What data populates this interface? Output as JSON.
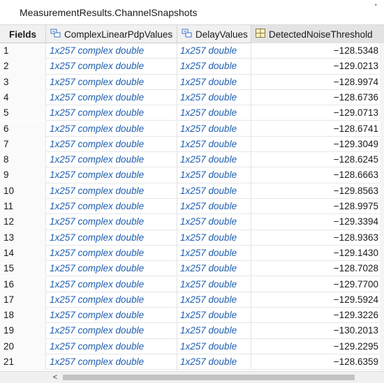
{
  "window": {
    "title": "MeasurementResults.ChannelSnapshots"
  },
  "table": {
    "headers": {
      "fields": "Fields",
      "col1": "ComplexLinearPdpValues",
      "col2": "DelayValues",
      "col3": "DetectedNoiseThreshold"
    },
    "header_icons": {
      "col1": "struct-field-icon",
      "col2": "struct-field-icon",
      "col3": "numeric-grid-icon"
    },
    "rows": [
      {
        "index": "1",
        "pdp": "1x257 complex double",
        "delay": "1x257 double",
        "noise": "−128.5348"
      },
      {
        "index": "2",
        "pdp": "1x257 complex double",
        "delay": "1x257 double",
        "noise": "−129.0213"
      },
      {
        "index": "3",
        "pdp": "1x257 complex double",
        "delay": "1x257 double",
        "noise": "−128.9974"
      },
      {
        "index": "4",
        "pdp": "1x257 complex double",
        "delay": "1x257 double",
        "noise": "−128.6736"
      },
      {
        "index": "5",
        "pdp": "1x257 complex double",
        "delay": "1x257 double",
        "noise": "−129.0713"
      },
      {
        "index": "6",
        "pdp": "1x257 complex double",
        "delay": "1x257 double",
        "noise": "−128.6741"
      },
      {
        "index": "7",
        "pdp": "1x257 complex double",
        "delay": "1x257 double",
        "noise": "−129.3049"
      },
      {
        "index": "8",
        "pdp": "1x257 complex double",
        "delay": "1x257 double",
        "noise": "−128.6245"
      },
      {
        "index": "9",
        "pdp": "1x257 complex double",
        "delay": "1x257 double",
        "noise": "−128.6663"
      },
      {
        "index": "10",
        "pdp": "1x257 complex double",
        "delay": "1x257 double",
        "noise": "−129.8563"
      },
      {
        "index": "11",
        "pdp": "1x257 complex double",
        "delay": "1x257 double",
        "noise": "−128.9975"
      },
      {
        "index": "12",
        "pdp": "1x257 complex double",
        "delay": "1x257 double",
        "noise": "−129.3394"
      },
      {
        "index": "13",
        "pdp": "1x257 complex double",
        "delay": "1x257 double",
        "noise": "−128.9363"
      },
      {
        "index": "14",
        "pdp": "1x257 complex double",
        "delay": "1x257 double",
        "noise": "−129.1430"
      },
      {
        "index": "15",
        "pdp": "1x257 complex double",
        "delay": "1x257 double",
        "noise": "−128.7028"
      },
      {
        "index": "16",
        "pdp": "1x257 complex double",
        "delay": "1x257 double",
        "noise": "−129.7700"
      },
      {
        "index": "17",
        "pdp": "1x257 complex double",
        "delay": "1x257 double",
        "noise": "−129.5924"
      },
      {
        "index": "18",
        "pdp": "1x257 complex double",
        "delay": "1x257 double",
        "noise": "−129.3226"
      },
      {
        "index": "19",
        "pdp": "1x257 complex double",
        "delay": "1x257 double",
        "noise": "−130.2013"
      },
      {
        "index": "20",
        "pdp": "1x257 complex double",
        "delay": "1x257 double",
        "noise": "−129.2295"
      },
      {
        "index": "21",
        "pdp": "1x257 complex double",
        "delay": "1x257 double",
        "noise": "−128.6359"
      }
    ]
  },
  "scrollbar": {
    "left_arrow": "<"
  },
  "colors": {
    "link_blue": "#1f5fb0",
    "header_bg": "#f0f0f0",
    "selected_header_bg": "#e3e3e3"
  }
}
